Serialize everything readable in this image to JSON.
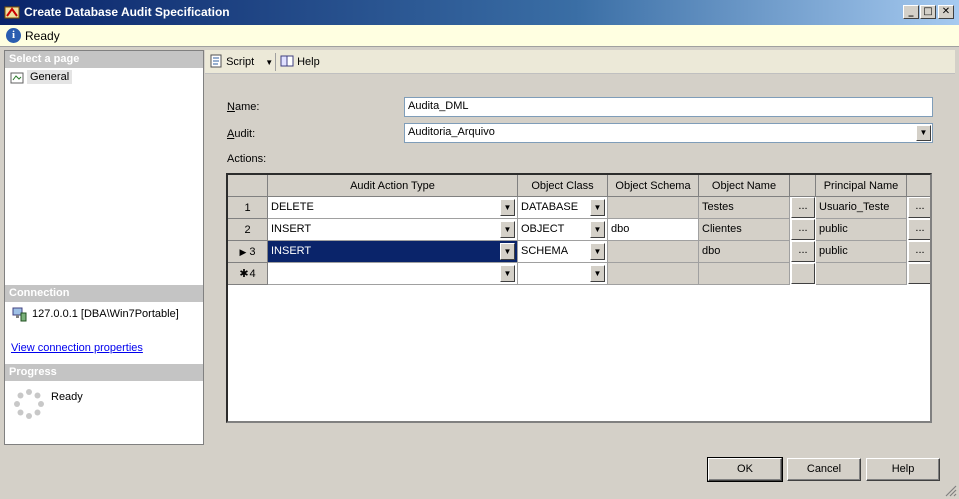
{
  "window": {
    "title": "Create Database Audit Specification",
    "minimize": "_",
    "maximize": "□",
    "close": "✕"
  },
  "status": {
    "text": "Ready",
    "icon": "info-icon"
  },
  "left": {
    "select_page_header": "Select a page",
    "pages": [
      {
        "label": "General"
      }
    ],
    "connection_header": "Connection",
    "connection_text": "127.0.0.1 [DBA\\Win7Portable]",
    "view_connection_link": "View connection properties",
    "progress_header": "Progress",
    "progress_text": "Ready"
  },
  "toolbar": {
    "script_label": "Script",
    "help_label": "Help"
  },
  "form": {
    "name_label_u": "N",
    "name_label_rest": "ame:",
    "name_value": "Audita_DML",
    "audit_label_u": "A",
    "audit_label_rest": "udit:",
    "audit_value": "Auditoria_Arquivo",
    "actions_label": "Actions:"
  },
  "grid": {
    "headers": [
      "Audit Action Type",
      "Object Class",
      "Object Schema",
      "Object Name",
      "",
      "Principal Name",
      ""
    ],
    "rows": [
      {
        "num": "1",
        "marker": "",
        "action": "DELETE",
        "class": "DATABASE",
        "schema": "",
        "name": "Testes",
        "principal": "Usuario_Teste"
      },
      {
        "num": "2",
        "marker": "",
        "action": "INSERT",
        "class": "OBJECT",
        "schema": "dbo",
        "name": "Clientes",
        "principal": "public"
      },
      {
        "num": "3",
        "marker": "▶",
        "action": "INSERT",
        "class": "SCHEMA",
        "schema": "",
        "name": "dbo",
        "principal": "public"
      },
      {
        "num": "4",
        "marker": "✱",
        "action": "",
        "class": "",
        "schema": "",
        "name": "",
        "principal": ""
      }
    ],
    "ellipsis": "..."
  },
  "buttons": {
    "ok": "OK",
    "cancel": "Cancel",
    "help": "Help"
  }
}
